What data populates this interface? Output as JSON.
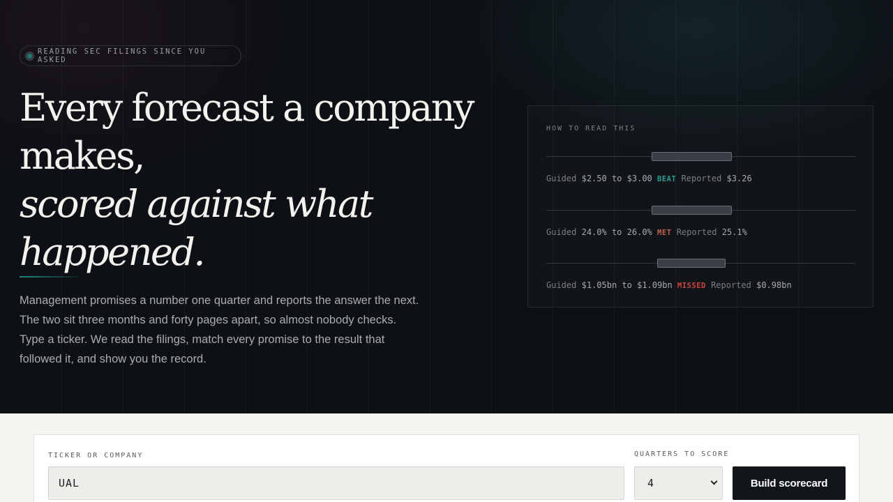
{
  "badge": {
    "text": "READING SEC FILINGS SINCE YOU ASKED"
  },
  "headline": {
    "line1": "Every forecast a company",
    "line2": "makes,",
    "line3": "scored against what",
    "line4": "happened."
  },
  "lede": "Management promises a number one quarter and reports the answer the next. The two sit three months and forty pages apart, so almost nobody checks. Type a ticker. We read the filings, match every promise to the result that followed it, and show you the record.",
  "howto": {
    "title": "HOW TO READ THIS",
    "rows": [
      {
        "guided_label": "Guided",
        "low": "$2.50",
        "to": "to",
        "high": "$3.00",
        "tag": "BEAT",
        "tag_color": "#2f9c8f",
        "reported_label": "Reported",
        "reported": "$3.26",
        "range_fraction": [
          0.34,
          0.6
        ]
      },
      {
        "guided_label": "Guided",
        "low": "24.0%",
        "to": "to",
        "high": "26.0%",
        "tag": "MET",
        "tag_color": "#c2614f",
        "reported_label": "Reported",
        "reported": "25.1%",
        "range_fraction": [
          0.34,
          0.6
        ]
      },
      {
        "guided_label": "Guided",
        "low": "$1.05bn",
        "to": "to",
        "high": "$1.09bn",
        "tag": "MISSED",
        "tag_color": "#c9463d",
        "reported_label": "Reported",
        "reported": "$0.98bn",
        "range_fraction": [
          0.36,
          0.58
        ]
      }
    ]
  },
  "form": {
    "ticker_label": "TICKER OR COMPANY",
    "ticker_value": "UAL",
    "quarters_label": "QUARTERS TO SCORE",
    "quarters_value": "4",
    "build_label": "Build scorecard"
  },
  "colors": {
    "accent": "#1f8a80",
    "dark": "#0d1015"
  }
}
